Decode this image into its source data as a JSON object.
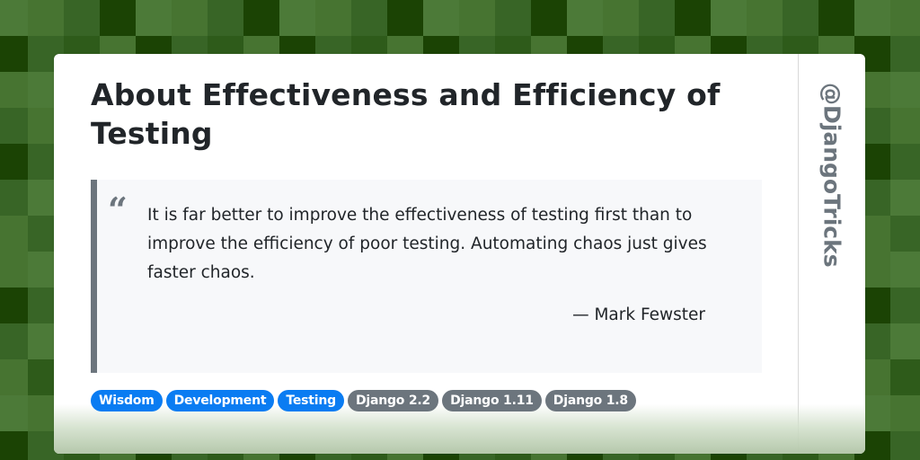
{
  "colors": {
    "background_shades": [
      "#477431",
      "#4c7a38",
      "#386526",
      "#1b4304",
      "#2e5b1a"
    ],
    "card_bg": "#ffffff",
    "title_color": "#212529",
    "quote_bg": "#f7f8fa",
    "quote_border": "#6c757d",
    "tag_primary": "#0a7cf2",
    "tag_secondary": "#6c757d",
    "handle_color": "#6c757d"
  },
  "card": {
    "title": "About Effectiveness and Efficiency of Testing",
    "quote_mark": "“",
    "quote": {
      "text": "It is far better to improve the effectiveness of testing first than to improve the efficiency of poor testing. Automating chaos just gives faster chaos.",
      "author": "— Mark Fewster"
    },
    "tags": [
      {
        "label": "Wisdom",
        "style": "primary"
      },
      {
        "label": "Development",
        "style": "primary"
      },
      {
        "label": "Testing",
        "style": "primary"
      },
      {
        "label": "Django 2.2",
        "style": "secondary"
      },
      {
        "label": "Django 1.11",
        "style": "secondary"
      },
      {
        "label": "Django 1.8",
        "style": "secondary"
      }
    ],
    "handle": "@DjangoTricks"
  }
}
